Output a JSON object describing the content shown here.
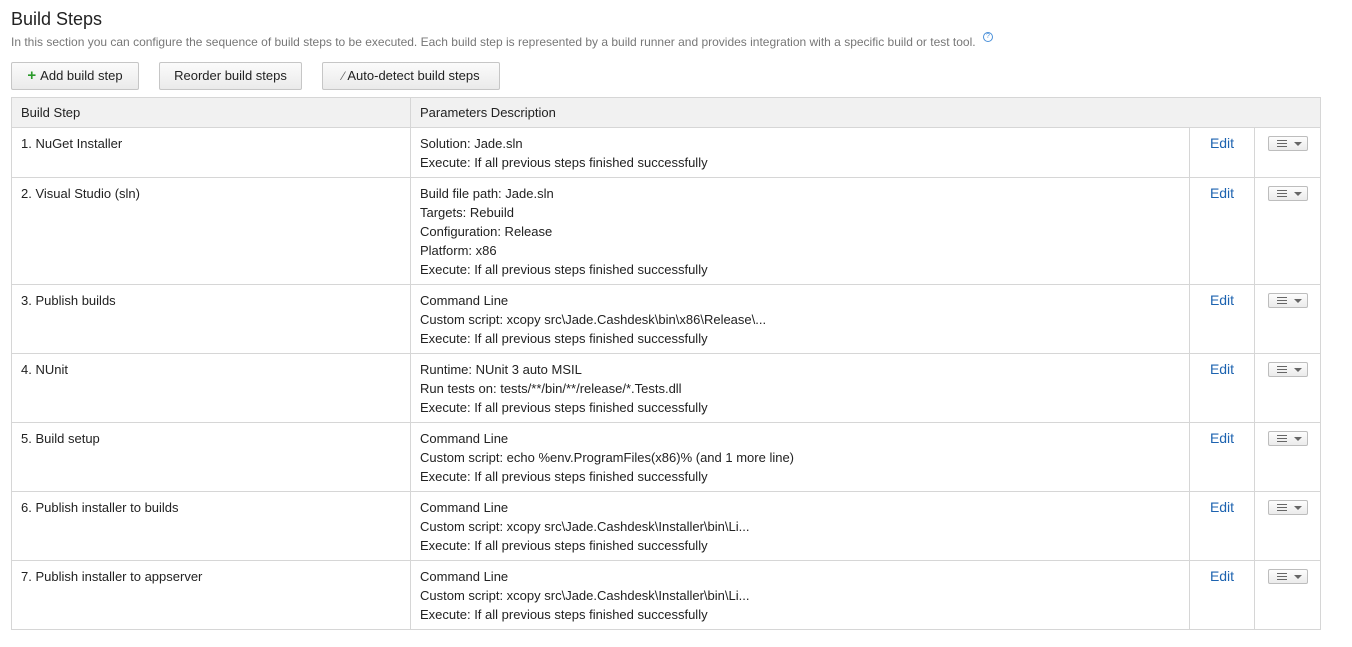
{
  "header": {
    "title": "Build Steps",
    "description": "In this section you can configure the sequence of build steps to be executed. Each build step is represented by a build runner and provides integration with a specific build or test tool.",
    "help_glyph": "?"
  },
  "toolbar": {
    "add_label": "Add build step",
    "reorder_label": "Reorder build steps",
    "autodetect_label": "Auto-detect build steps"
  },
  "table": {
    "columns": [
      "Build Step",
      "Parameters Description"
    ],
    "edit_label": "Edit",
    "rows": [
      {
        "name": "1. NuGet Installer",
        "params": [
          "Solution: Jade.sln",
          "Execute: If all previous steps finished successfully"
        ]
      },
      {
        "name": "2. Visual Studio (sln)",
        "params": [
          "Build file path: Jade.sln",
          "Targets: Rebuild",
          "Configuration: Release",
          "Platform: x86",
          "Execute: If all previous steps finished successfully"
        ]
      },
      {
        "name": "3. Publish builds",
        "params": [
          "Command Line",
          "Custom script: xcopy src\\Jade.Cashdesk\\bin\\x86\\Release\\...",
          "Execute: If all previous steps finished successfully"
        ]
      },
      {
        "name": "4. NUnit",
        "params": [
          "Runtime: NUnit 3 auto MSIL",
          "Run tests on: tests/**/bin/**/release/*.Tests.dll",
          "Execute: If all previous steps finished successfully"
        ]
      },
      {
        "name": "5. Build setup",
        "params": [
          "Command Line",
          "Custom script: echo %env.ProgramFiles(x86)% (and 1 more line)",
          "Execute: If all previous steps finished successfully"
        ]
      },
      {
        "name": "6. Publish installer to builds",
        "params": [
          "Command Line",
          "Custom script: xcopy src\\Jade.Cashdesk\\Installer\\bin\\Li...",
          "Execute: If all previous steps finished successfully"
        ]
      },
      {
        "name": "7. Publish installer to appserver",
        "params": [
          "Command Line",
          "Custom script: xcopy src\\Jade.Cashdesk\\Installer\\bin\\Li...",
          "Execute: If all previous steps finished successfully"
        ]
      }
    ]
  },
  "colors": {
    "link": "#1d63b0",
    "add_icon": "#2a9a2a",
    "header_bg": "#f1f1f1",
    "border": "#d6d6d6"
  }
}
